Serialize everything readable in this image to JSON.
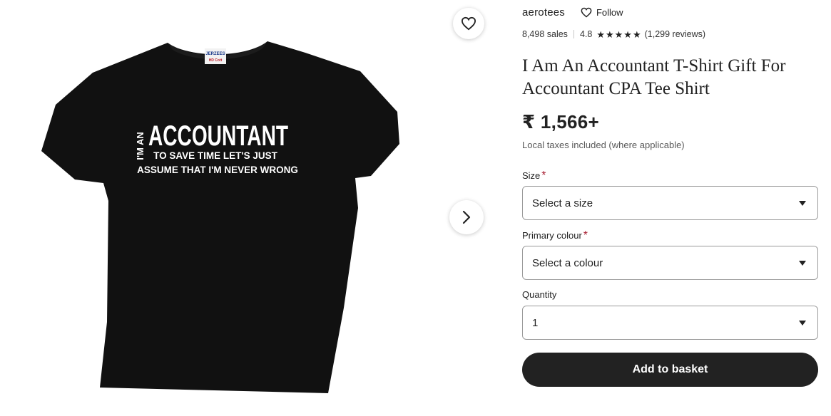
{
  "shop": {
    "name": "aerotees",
    "follow_label": "Follow"
  },
  "stats": {
    "sales": "8,498 sales",
    "rating": "4.8",
    "reviews": "(1,299 reviews)",
    "stars": 5
  },
  "product": {
    "title": "I Am An Accountant T-Shirt Gift For Accountant CPA Tee Shirt",
    "price": "₹ 1,566+",
    "tax_note": "Local taxes included (where applicable)"
  },
  "shirt_print": {
    "tag_top": "JERZEES",
    "tag_bottom": "HD Cott",
    "prefix": "I'M AN",
    "headline": "ACCOUNTANT",
    "line1": "TO SAVE TIME LET'S JUST",
    "line2": "ASSUME THAT I'M NEVER WRONG"
  },
  "options": {
    "size": {
      "label": "Size",
      "required_mark": "*",
      "value": "Select a size"
    },
    "colour": {
      "label": "Primary colour",
      "required_mark": "*",
      "value": "Select a colour"
    },
    "quantity": {
      "label": "Quantity",
      "value": "1"
    }
  },
  "actions": {
    "add_to_basket": "Add to basket"
  },
  "icons": {
    "favorite": "heart-icon",
    "next": "chevron-right-icon",
    "follow": "heart-icon",
    "star": "star-icon",
    "dropdown": "caret-down-icon"
  },
  "colors": {
    "button_bg": "#222222",
    "required": "#a61a2e",
    "shirt": "#111111"
  }
}
